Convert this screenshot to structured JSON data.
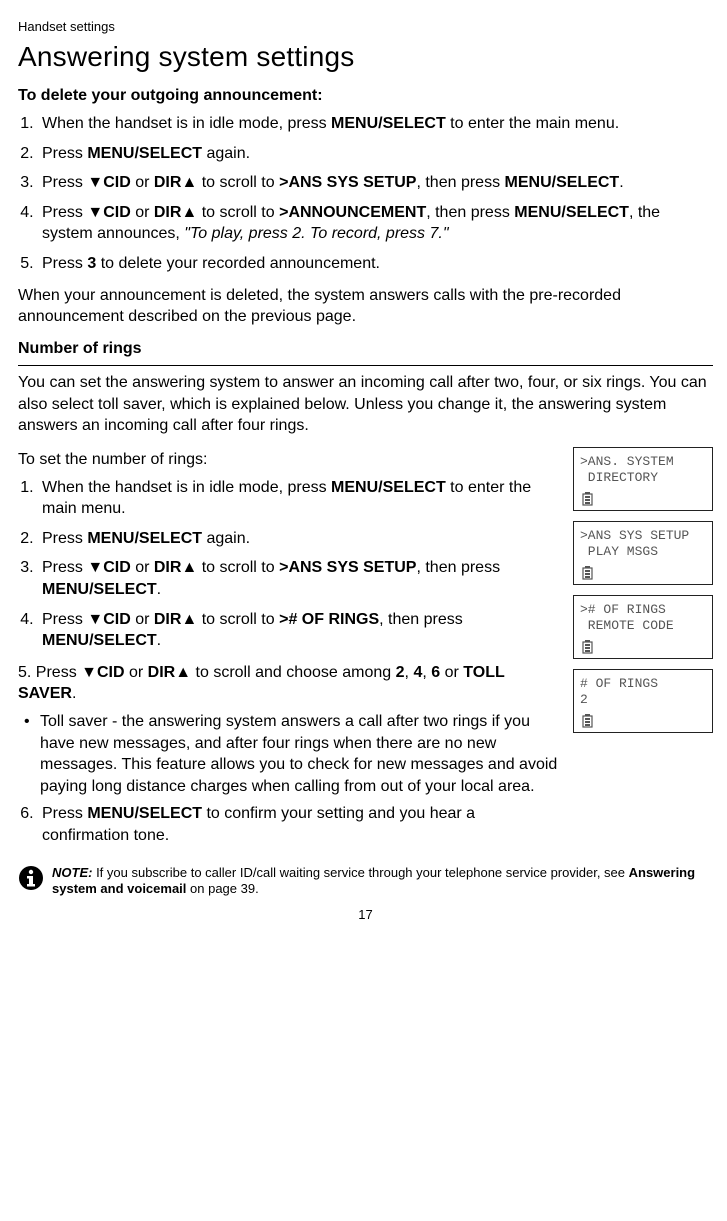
{
  "header": {
    "small": "Handset settings"
  },
  "title": "Answering system settings",
  "section1": {
    "heading": "To delete your outgoing announcement:",
    "step1_a": "When the handset is in idle mode, press ",
    "step1_b": "MENU/",
    "step1_c": "SELECT",
    "step1_d": " to enter the main menu.",
    "step2_a": "Press ",
    "step2_b": "MENU",
    "step2_c": "/SELECT",
    "step2_d": " again.",
    "step3_a": "Press ",
    "cid": "CID",
    "dir": "DIR",
    "or": " or ",
    "step3_b": " to scroll to ",
    "step3_target": ">ANS SYS SETUP",
    "step3_c": ", then press ",
    "step3_menu": "MENU",
    "step3_sel": "/SELECT",
    "step3_d": ".",
    "step4_target": ">ANNOUNCEMENT",
    "step4_ann": ", the system announces, ",
    "step4_quote": "\"To play, press 2. To record, press 7.\"",
    "step5_a": "Press ",
    "step5_b": "3",
    "step5_c": " to delete your recorded announcement.",
    "trailer": "When your announcement is deleted, the system answers calls with the pre-recorded announcement described on the previous page."
  },
  "section2": {
    "heading": "Number of rings",
    "intro": "You can set the answering system to answer an incoming call after two, four, or six rings. You can also select toll saver, which is explained below. Unless you change it, the answering system answers an incoming call after four rings.",
    "setline": "To set the number of rings:",
    "s1_a": "When the handset is in idle mode, press ",
    "s1_b": "MENU/",
    "s1_c": "SELECT",
    "s1_d": " to enter the main menu.",
    "s2_a": "Press ",
    "s2_b": "MENU",
    "s2_c": "/SELECT",
    "s2_d": " again.",
    "s3_b": " to scroll to ",
    "s3_target": ">ANS SYS SETUP",
    "s3_c": ", then press ",
    "s3_menu": "MENU",
    "s3_sel": "/SELECT",
    "s3_d": ".",
    "s4_target": "># OF RINGS",
    "s4_c": ", then press ",
    "s5_a": "5. Press ",
    "s5_b": " to scroll and choose among ",
    "s5_2": "2",
    "s5_4": "4",
    "s5_6": "6",
    "s5_or": " or ",
    "s5_ts": "TOLL SAVER",
    "s5_d": ".",
    "bullet": "Toll saver - the answering system answers a call after two rings if you have new messages, and after four rings when there are no new messages. This feature allows you to check for new messages and avoid paying long distance charges when calling from out of your local area.",
    "s6_a": "Press ",
    "s6_b": "MENU",
    "s6_c": "/SELECT",
    "s6_d": " to confirm your setting and you hear a confirmation tone."
  },
  "lcds": {
    "a1": ">ANS. SYSTEM",
    "a2": " DIRECTORY",
    "b1": ">ANS SYS SETUP",
    "b2": " PLAY MSGS",
    "c1": "># OF RINGS",
    "c2": " REMOTE CODE",
    "d1": "# OF RINGS",
    "d2": "2"
  },
  "note": {
    "label": "NOTE:",
    "text_a": " If you subscribe to caller ID/call waiting service through your telephone service provider, see ",
    "text_b": "Answering system and voicemail",
    "text_c": " on page 39."
  },
  "page": "17",
  "glyph": {
    "down": "▼",
    "up": "▲",
    "comma": ", "
  }
}
